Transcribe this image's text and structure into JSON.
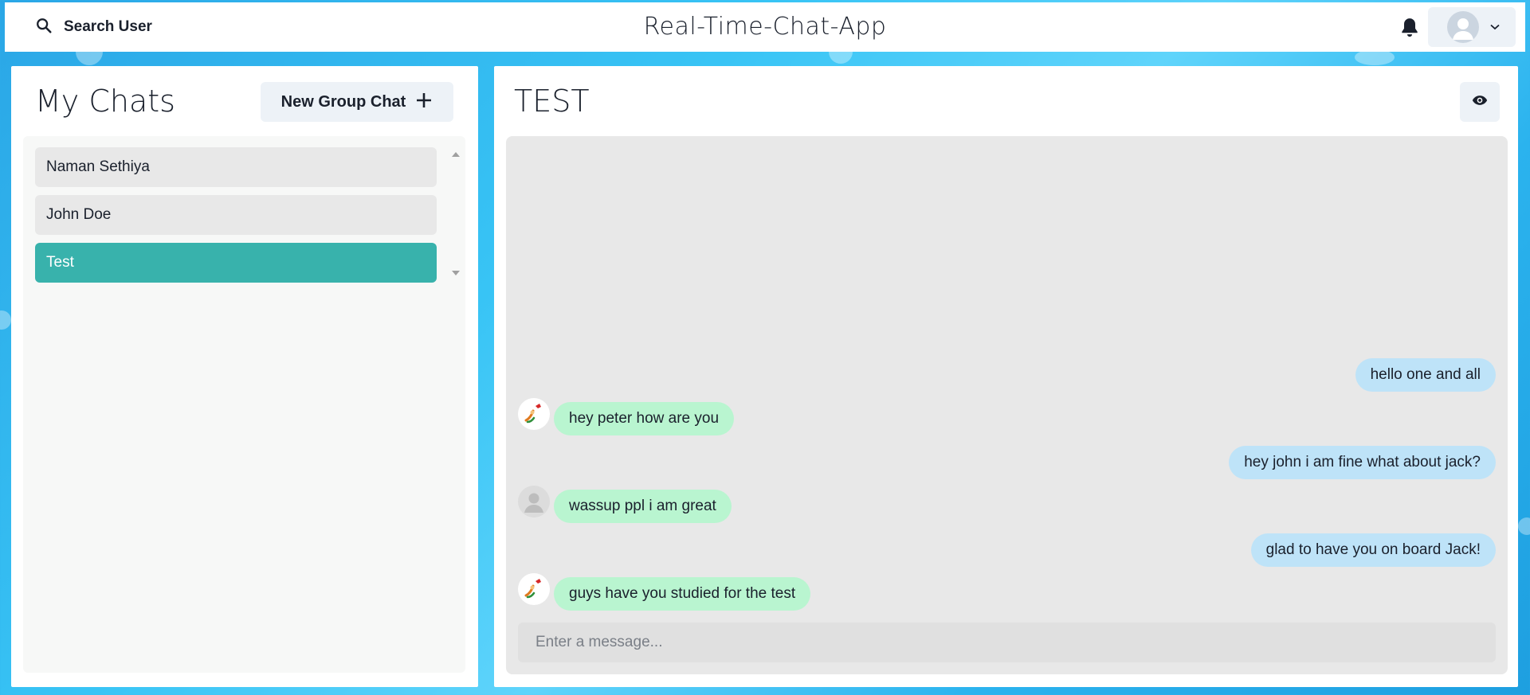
{
  "header": {
    "search_label": "Search User",
    "app_title": "Real-Time-Chat-App",
    "icons": {
      "search": "search-icon",
      "bell": "bell-icon",
      "avatar": "user-avatar-icon",
      "chevron": "chevron-down-icon"
    }
  },
  "sidebar": {
    "title": "My Chats",
    "new_group_label": "New Group Chat",
    "chats": [
      {
        "name": "Naman Sethiya",
        "active": false
      },
      {
        "name": "John Doe",
        "active": false
      },
      {
        "name": "Test",
        "active": true
      }
    ]
  },
  "chat": {
    "title": "TEST",
    "messages": [
      {
        "text": "hello one and all",
        "sender": "me"
      },
      {
        "text": "hey peter how are you",
        "sender": "other",
        "avatar": "cartoon"
      },
      {
        "text": "hey john i am fine what about jack?",
        "sender": "me"
      },
      {
        "text": "wassup ppl i am great",
        "sender": "other",
        "avatar": "default"
      },
      {
        "text": "glad to have you on board Jack!",
        "sender": "me"
      },
      {
        "text": "guys have you studied for the test",
        "sender": "other",
        "avatar": "cartoon"
      }
    ],
    "input_placeholder": "Enter a message..."
  },
  "colors": {
    "active_chat": "#38b2ac",
    "my_bubble": "#bee3f8",
    "their_bubble": "#b9f5d0",
    "background": "#38c4f5"
  }
}
